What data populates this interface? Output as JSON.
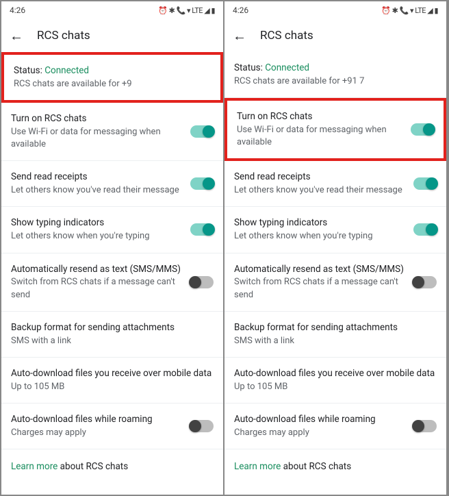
{
  "screens": [
    {
      "time": "4:26",
      "title": "RCS chats",
      "status_section": {
        "label": "Status:",
        "value": "Connected",
        "sub": "RCS chats are available for +9",
        "highlight": true
      },
      "rcs_toggle": {
        "title": "Turn on RCS chats",
        "sub": "Use Wi-Fi or data for messaging when available",
        "on": true,
        "highlight": false
      }
    },
    {
      "time": "4:26",
      "title": "RCS chats",
      "status_section": {
        "label": "Status:",
        "value": "Connected",
        "sub": "RCS chats are available for +91 7",
        "highlight": false
      },
      "rcs_toggle": {
        "title": "Turn on RCS chats",
        "sub": "Use Wi-Fi or data for messaging when available",
        "on": true,
        "highlight": true
      }
    }
  ],
  "common": {
    "read_receipts": {
      "title": "Send read receipts",
      "sub": "Let others know you've read their message",
      "on": true
    },
    "typing": {
      "title": "Show typing indicators",
      "sub": "Let others know when you're typing",
      "on": true
    },
    "auto_resend": {
      "title": "Automatically resend as text (SMS/MMS)",
      "sub": "Switch from RCS chats if a message can't send",
      "on": false
    },
    "backup": {
      "title": "Backup format for sending attachments",
      "sub": "SMS with a link"
    },
    "auto_dl_mobile": {
      "title": "Auto-download files you receive over mobile data",
      "sub": "Up to 105 MB"
    },
    "auto_dl_roam": {
      "title": "Auto-download files while roaming",
      "sub": "Charges may apply",
      "on": false
    },
    "learn_more_link": "Learn more",
    "learn_more_rest": " about RCS chats"
  },
  "status_icons": "⏰ ✱ 📞 ▾ LTE ◢ ▮"
}
